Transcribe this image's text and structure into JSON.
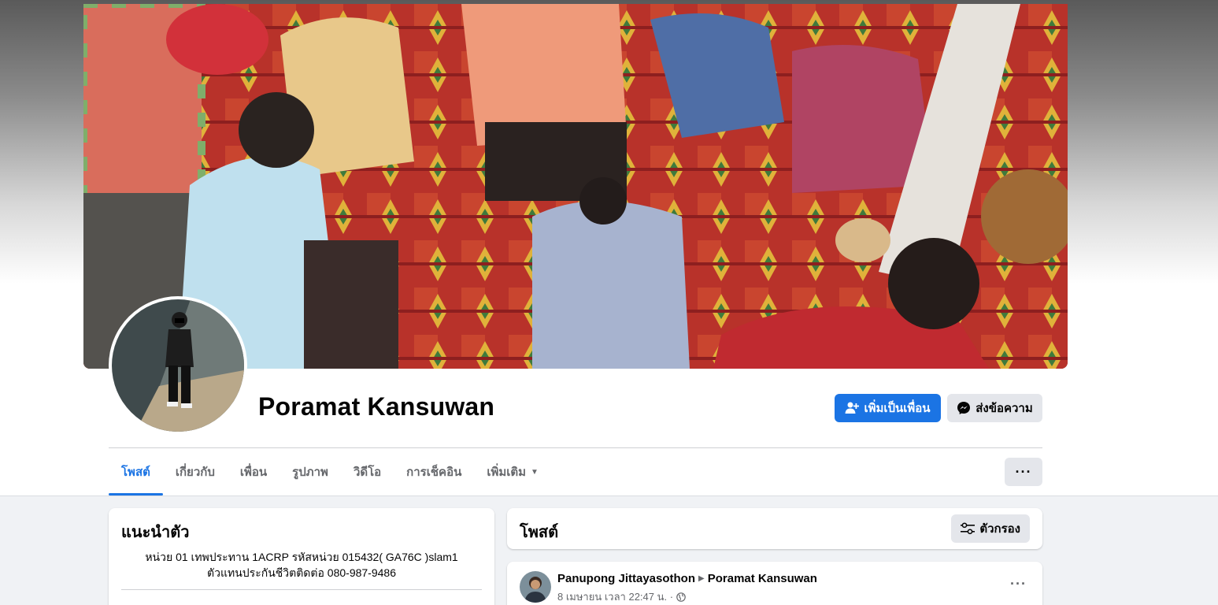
{
  "profile": {
    "name": "Poramat Kansuwan",
    "add_friend_label": "เพิ่มเป็นเพื่อน",
    "message_label": "ส่งข้อความ"
  },
  "tabs": [
    {
      "label": "โพสต์",
      "active": true
    },
    {
      "label": "เกี่ยวกับ"
    },
    {
      "label": "เพื่อน"
    },
    {
      "label": "รูปภาพ"
    },
    {
      "label": "วิดีโอ"
    },
    {
      "label": "การเช็คอิน"
    },
    {
      "label": "เพิ่มเติม"
    }
  ],
  "more_button_label": "···",
  "intro": {
    "title": "แนะนำตัว",
    "bio_line1": "หน่วย 01 เทพประทาน 1ACRP รหัสหน่วย 015432( GA76C )slam1",
    "bio_line2": "ตัวแทนประกันชีวิตติดต่อ 080-987-9486"
  },
  "posts_section": {
    "title": "โพสต์",
    "filter_label": "ตัวกรอง"
  },
  "post": {
    "author": "Panupong Jittayasothon",
    "target": "Poramat Kansuwan",
    "meta": "8 เมษายน เวลา 22:47 น. ·",
    "menu_label": "···"
  },
  "colors": {
    "accent": "#1b74e4",
    "secondary_button": "#e4e6eb",
    "page_background": "#f0f2f5"
  }
}
